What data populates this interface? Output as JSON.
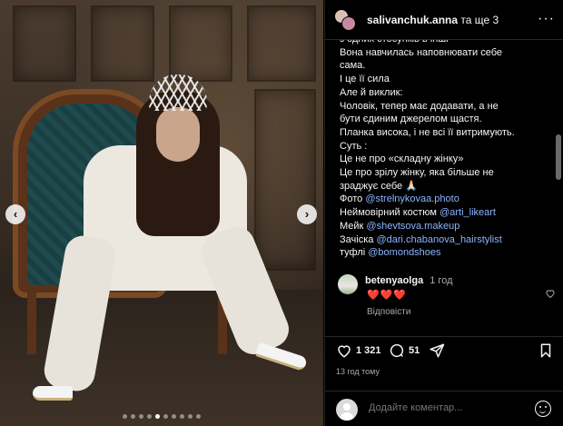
{
  "post": {
    "header": {
      "username": "salivanchuk.anna",
      "suffix": "та ще 3",
      "more_label": "···"
    },
    "media": {
      "prev_label": "‹",
      "next_label": "›",
      "dot_count": 10,
      "active_dot": 4,
      "icons": [
        "chevron-left-icon",
        "chevron-right-icon"
      ]
    },
    "caption": [
      {
        "segments": [
          {
            "text": "з одних стосунків в інші"
          }
        ]
      },
      {
        "segments": [
          {
            "text": "Вона навчилась наповнювати себе"
          }
        ]
      },
      {
        "segments": [
          {
            "text": "сама."
          }
        ]
      },
      {
        "segments": [
          {
            "text": "І це її сила"
          }
        ]
      },
      {
        "segments": [
          {
            "text": "Але й виклик:"
          }
        ]
      },
      {
        "segments": [
          {
            "text": "Чоловік, тепер має додавати, а не"
          }
        ]
      },
      {
        "segments": [
          {
            "text": "бути єдиним джерелом щастя."
          }
        ]
      },
      {
        "segments": [
          {
            "text": "Планка висока, і не всі її витримують."
          }
        ]
      },
      {
        "segments": [
          {
            "text": "Суть :"
          }
        ]
      },
      {
        "segments": [
          {
            "text": "Це не про «складну жінку»"
          }
        ]
      },
      {
        "segments": [
          {
            "text": "Це про зрілу жінку, яка більше не"
          }
        ]
      },
      {
        "segments": [
          {
            "text": "зраджує себе 🙏🏻"
          }
        ]
      },
      {
        "segments": [
          {
            "text": "Фото "
          },
          {
            "text": "@strelnykovaa.photo",
            "link": true
          }
        ]
      },
      {
        "segments": [
          {
            "text": "Неймовірний костюм "
          },
          {
            "text": "@arti_likeart",
            "link": true
          }
        ]
      },
      {
        "segments": [
          {
            "text": "Мейк "
          },
          {
            "text": "@shevtsova.makeup",
            "link": true
          }
        ]
      },
      {
        "segments": [
          {
            "text": "Зачіска "
          },
          {
            "text": "@dari.chabanova_hairstylist",
            "link": true
          }
        ]
      },
      {
        "segments": [
          {
            "text": "туфлі "
          },
          {
            "text": "@bomondshoes",
            "link": true
          }
        ]
      }
    ],
    "comment": {
      "username": "betenyaolga",
      "time": "1 год",
      "text": "❤️❤️❤️",
      "reply_label": "Відповісти"
    },
    "actions": {
      "likes": "1 321",
      "comments": "51"
    },
    "timestamp": "13 год тому",
    "add_comment": {
      "placeholder": "Додайте коментар..."
    },
    "colors": {
      "link": "#8ab4ff",
      "muted": "#a8a8a8",
      "heart": "#ff3040",
      "background": "#000000"
    }
  }
}
